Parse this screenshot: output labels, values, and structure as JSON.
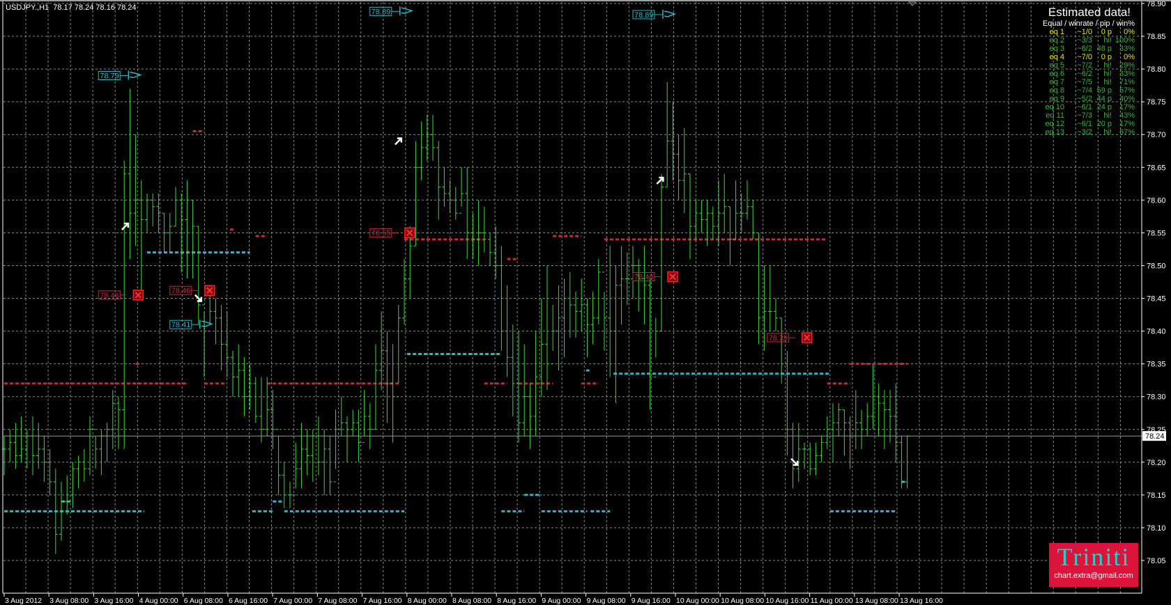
{
  "header": {
    "symbol_line": "USDJPY.,H1  78.17 78.24 78.16 78.24"
  },
  "stats": {
    "title": "Estimated data!",
    "header": "Equal / winrate / pip / win%",
    "rows": [
      {
        "eq": "eq 1",
        "rate": "~1/0",
        "pip": "0 p",
        "win": "0%",
        "color": "#e8e800"
      },
      {
        "eq": "eq 2",
        "rate": "~3/3",
        "pip": "hi!",
        "win": "100%",
        "color": "#3cb43c"
      },
      {
        "eq": "eq 3",
        "rate": "~6/2",
        "pip": "48 p",
        "win": "33%",
        "color": "#3cb43c"
      },
      {
        "eq": "eq 4",
        "rate": "~7/0",
        "pip": "0 p",
        "win": "0%",
        "color": "#e8e800"
      },
      {
        "eq": "eq 5",
        "rate": "~7/2",
        "pip": "hi!",
        "win": "29%",
        "color": "#3cb43c"
      },
      {
        "eq": "eq 6",
        "rate": "~6/2",
        "pip": "hi!",
        "win": "33%",
        "color": "#3cb43c"
      },
      {
        "eq": "eq 7",
        "rate": "~7/5",
        "pip": "hi!",
        "win": "71%",
        "color": "#3cb43c"
      },
      {
        "eq": "eq 8",
        "rate": "~7/4",
        "pip": "59 p",
        "win": "57%",
        "color": "#3cb43c"
      },
      {
        "eq": "eq 9",
        "rate": "~5/2",
        "pip": "44 p",
        "win": "40%",
        "color": "#3cb43c"
      },
      {
        "eq": "eq 10",
        "rate": "~6/1",
        "pip": "24 p",
        "win": "17%",
        "color": "#3cb43c"
      },
      {
        "eq": "eq 11",
        "rate": "~7/3",
        "pip": "hi!",
        "win": "43%",
        "color": "#3cb43c"
      },
      {
        "eq": "eq 12",
        "rate": "~6/1",
        "pip": "20 p",
        "win": "17%",
        "color": "#3cb43c"
      },
      {
        "eq": "eq 13",
        "rate": "~3/2",
        "pip": "hi!",
        "win": "67%",
        "color": "#3cb43c"
      }
    ]
  },
  "logo": {
    "brand": "Triniti",
    "email": "chart.extra@gmail.com"
  },
  "colors": {
    "bar": "#3ed83e",
    "grid": "#8a8a8a",
    "red": "#c8283c",
    "cyan": "#2ab8c8",
    "axis": "#ffffff"
  },
  "chart_data": {
    "type": "ohlc",
    "title": "USDJPY.,H1",
    "ylim": [
      78.03,
      78.9
    ],
    "y_ticks": [
      "78.90",
      "78.85",
      "78.80",
      "78.75",
      "78.70",
      "78.65",
      "78.60",
      "78.55",
      "78.50",
      "78.45",
      "78.40",
      "78.35",
      "78.30",
      "78.25",
      "78.20",
      "78.15",
      "78.10",
      "78.05"
    ],
    "current_price": "78.24",
    "x_ticks": [
      "3 Aug 2012",
      "3 Aug 08:00",
      "3 Aug 16:00",
      "4 Aug 00:00",
      "6 Aug 08:00",
      "6 Aug 16:00",
      "7 Aug 00:00",
      "7 Aug 08:00",
      "7 Aug 16:00",
      "8 Aug 00:00",
      "8 Aug 08:00",
      "8 Aug 16:00",
      "9 Aug 00:00",
      "9 Aug 08:00",
      "9 Aug 16:00",
      "10 Aug 00:00",
      "10 Aug 08:00",
      "10 Aug 16:00",
      "11 Aug 00:00",
      "13 Aug 08:00",
      "13 Aug 16:00"
    ],
    "bars_hlc": [
      [
        78.24,
        78.18,
        78.22
      ],
      [
        78.25,
        78.2,
        78.23
      ],
      [
        78.26,
        78.19,
        78.21
      ],
      [
        78.27,
        78.2,
        78.22
      ],
      [
        78.25,
        78.19,
        78.24
      ],
      [
        78.27,
        78.18,
        78.21
      ],
      [
        78.26,
        78.19,
        78.22
      ],
      [
        78.24,
        78.17,
        78.2
      ],
      [
        78.22,
        78.15,
        78.17
      ],
      [
        78.19,
        78.06,
        78.09
      ],
      [
        78.17,
        78.08,
        78.14
      ],
      [
        78.18,
        78.12,
        78.15
      ],
      [
        78.2,
        78.13,
        78.19
      ],
      [
        78.21,
        78.16,
        78.2
      ],
      [
        78.22,
        78.17,
        78.19
      ],
      [
        78.27,
        78.18,
        78.25
      ],
      [
        78.24,
        78.19,
        78.22
      ],
      [
        78.25,
        78.18,
        78.24
      ],
      [
        78.26,
        78.2,
        78.25
      ],
      [
        78.31,
        78.22,
        78.29
      ],
      [
        78.3,
        78.22,
        78.28
      ],
      [
        78.66,
        78.22,
        78.64
      ],
      [
        78.77,
        78.51,
        78.58
      ],
      [
        78.7,
        78.53,
        78.6
      ],
      [
        78.63,
        78.45,
        78.57
      ],
      [
        78.61,
        78.55,
        78.6
      ],
      [
        78.61,
        78.56,
        78.59
      ],
      [
        78.61,
        78.55,
        78.58
      ],
      [
        78.58,
        78.52,
        78.55
      ],
      [
        78.58,
        78.52,
        78.56
      ],
      [
        78.62,
        78.56,
        78.6
      ],
      [
        78.61,
        78.49,
        78.57
      ],
      [
        78.63,
        78.48,
        78.6
      ],
      [
        78.6,
        78.48,
        78.56
      ],
      [
        78.56,
        78.41,
        78.44
      ],
      [
        78.43,
        78.33,
        78.4
      ],
      [
        78.46,
        78.41,
        78.43
      ],
      [
        78.45,
        78.38,
        78.42
      ],
      [
        78.44,
        78.34,
        78.38
      ],
      [
        78.43,
        78.33,
        78.36
      ],
      [
        78.37,
        78.3,
        78.33
      ],
      [
        78.38,
        78.3,
        78.34
      ],
      [
        78.36,
        78.27,
        78.3
      ],
      [
        78.35,
        78.28,
        78.32
      ],
      [
        78.33,
        78.26,
        78.27
      ],
      [
        78.33,
        78.23,
        78.25
      ],
      [
        78.33,
        78.24,
        78.28
      ],
      [
        78.31,
        78.22,
        78.25
      ],
      [
        78.24,
        78.15,
        78.18
      ],
      [
        78.2,
        78.13,
        78.15
      ],
      [
        78.17,
        78.13,
        78.15
      ],
      [
        78.23,
        78.16,
        78.19
      ],
      [
        78.26,
        78.16,
        78.22
      ],
      [
        78.25,
        78.18,
        78.21
      ],
      [
        78.25,
        78.17,
        78.24
      ],
      [
        78.27,
        78.18,
        78.2
      ],
      [
        78.25,
        78.15,
        78.22
      ],
      [
        78.24,
        78.15,
        78.17
      ],
      [
        78.28,
        78.19,
        78.25
      ],
      [
        78.3,
        78.24,
        78.26
      ],
      [
        78.27,
        78.2,
        78.25
      ],
      [
        78.28,
        78.24,
        78.26
      ],
      [
        78.28,
        78.2,
        78.23
      ],
      [
        78.31,
        78.24,
        78.27
      ],
      [
        78.29,
        78.22,
        78.25
      ],
      [
        78.38,
        78.25,
        78.34
      ],
      [
        78.43,
        78.31,
        78.37
      ],
      [
        78.4,
        78.26,
        78.32
      ],
      [
        78.38,
        78.23,
        78.3
      ],
      [
        78.44,
        78.32,
        78.42
      ],
      [
        78.51,
        78.41,
        78.48
      ],
      [
        78.56,
        78.45,
        78.53
      ],
      [
        78.69,
        78.53,
        78.65
      ],
      [
        78.72,
        78.63,
        78.68
      ],
      [
        78.73,
        78.66,
        78.7
      ],
      [
        78.73,
        78.66,
        78.68
      ],
      [
        78.69,
        78.57,
        78.62
      ],
      [
        78.65,
        78.59,
        78.61
      ],
      [
        78.63,
        78.58,
        78.6
      ],
      [
        78.62,
        78.57,
        78.58
      ],
      [
        78.65,
        78.59,
        78.61
      ],
      [
        78.65,
        78.51,
        78.55
      ],
      [
        78.58,
        78.51,
        78.54
      ],
      [
        78.6,
        78.5,
        78.55
      ],
      [
        78.59,
        78.52,
        78.54
      ],
      [
        78.55,
        78.5,
        78.52
      ],
      [
        78.56,
        78.48,
        78.5
      ],
      [
        78.53,
        78.37,
        78.4
      ],
      [
        78.47,
        78.33,
        78.36
      ],
      [
        78.41,
        78.27,
        78.32
      ],
      [
        78.4,
        78.23,
        78.26
      ],
      [
        78.38,
        78.24,
        78.3
      ],
      [
        78.32,
        78.22,
        78.27
      ],
      [
        78.4,
        78.24,
        78.33
      ],
      [
        78.45,
        78.3,
        78.38
      ],
      [
        78.5,
        78.31,
        78.35
      ],
      [
        78.44,
        78.37,
        78.4
      ],
      [
        78.47,
        78.34,
        78.42
      ],
      [
        78.48,
        78.36,
        78.45
      ],
      [
        78.49,
        78.39,
        78.44
      ],
      [
        78.46,
        78.39,
        78.43
      ],
      [
        78.48,
        78.4,
        78.44
      ],
      [
        78.45,
        78.36,
        78.41
      ],
      [
        78.46,
        78.38,
        78.42
      ],
      [
        78.51,
        78.41,
        78.49
      ],
      [
        78.46,
        78.37,
        78.42
      ],
      [
        78.53,
        78.33,
        78.4
      ],
      [
        78.5,
        78.29,
        78.47
      ],
      [
        78.53,
        78.41,
        78.48
      ],
      [
        78.52,
        78.44,
        78.48
      ],
      [
        78.53,
        78.45,
        78.5
      ],
      [
        78.51,
        78.43,
        78.48
      ],
      [
        78.53,
        78.41,
        78.47
      ],
      [
        78.48,
        78.28,
        78.33
      ],
      [
        78.42,
        78.36,
        78.4
      ],
      [
        78.64,
        78.4,
        78.62
      ],
      [
        78.78,
        78.62,
        78.69
      ],
      [
        78.75,
        78.63,
        78.67
      ],
      [
        78.7,
        78.6,
        78.63
      ],
      [
        78.71,
        78.58,
        78.64
      ],
      [
        78.64,
        78.51,
        78.56
      ],
      [
        78.6,
        78.54,
        78.58
      ],
      [
        78.6,
        78.55,
        78.57
      ],
      [
        78.6,
        78.53,
        78.58
      ],
      [
        78.59,
        78.54,
        78.56
      ],
      [
        78.63,
        78.53,
        78.58
      ],
      [
        78.64,
        78.55,
        78.59
      ],
      [
        78.59,
        78.5,
        78.54
      ],
      [
        78.63,
        78.54,
        78.58
      ],
      [
        78.61,
        78.55,
        78.58
      ],
      [
        78.63,
        78.57,
        78.59
      ],
      [
        78.6,
        78.54,
        78.55
      ],
      [
        78.55,
        78.38,
        78.42
      ],
      [
        78.5,
        78.37,
        78.43
      ],
      [
        78.5,
        78.4,
        78.43
      ],
      [
        78.45,
        78.4,
        78.42
      ],
      [
        78.42,
        78.32,
        78.35
      ],
      [
        78.37,
        78.21,
        78.25
      ],
      [
        78.26,
        78.16,
        78.19
      ],
      [
        78.26,
        78.17,
        78.22
      ],
      [
        78.23,
        78.19,
        78.22
      ],
      [
        78.23,
        78.18,
        78.19
      ],
      [
        78.23,
        78.18,
        78.21
      ],
      [
        78.24,
        78.2,
        78.23
      ],
      [
        78.27,
        78.22,
        78.25
      ],
      [
        78.29,
        78.2,
        78.26
      ],
      [
        78.29,
        78.24,
        78.28
      ],
      [
        78.28,
        78.21,
        78.26
      ],
      [
        78.27,
        78.19,
        78.24
      ],
      [
        78.31,
        78.22,
        78.26
      ],
      [
        78.28,
        78.22,
        78.25
      ],
      [
        78.29,
        78.24,
        78.27
      ],
      [
        78.35,
        78.25,
        78.3
      ],
      [
        78.32,
        78.24,
        78.29
      ],
      [
        78.31,
        78.22,
        78.28
      ],
      [
        78.31,
        78.23,
        78.27
      ],
      [
        78.32,
        78.2,
        78.23
      ],
      [
        78.24,
        78.16,
        78.17
      ],
      [
        78.24,
        78.16,
        78.24
      ]
    ],
    "levels": [
      {
        "price": 78.32,
        "from": 0,
        "to": 32,
        "color": "red"
      },
      {
        "price": 78.32,
        "from": 35,
        "to": 39,
        "color": "red"
      },
      {
        "price": 78.32,
        "from": 46,
        "to": 69,
        "color": "red"
      },
      {
        "price": 78.32,
        "from": 84,
        "to": 88,
        "color": "red"
      },
      {
        "price": 78.32,
        "from": 90,
        "to": 96,
        "color": "red"
      },
      {
        "price": 78.32,
        "from": 101,
        "to": 104,
        "color": "red"
      },
      {
        "price": 78.32,
        "from": 144,
        "to": 148,
        "color": "red"
      },
      {
        "price": 78.54,
        "from": 70,
        "to": 84,
        "color": "red"
      },
      {
        "price": 78.54,
        "from": 105,
        "to": 144,
        "color": "red"
      },
      {
        "price": 78.705,
        "from": 33,
        "to": 35,
        "color": "red"
      },
      {
        "price": 78.545,
        "from": 44,
        "to": 46,
        "color": "red"
      },
      {
        "price": 78.51,
        "from": 88,
        "to": 90,
        "color": "red"
      },
      {
        "price": 78.555,
        "from": 39.5,
        "to": 40.3,
        "color": "red"
      },
      {
        "price": 78.35,
        "from": 148,
        "to": 158,
        "color": "red"
      },
      {
        "price": 78.545,
        "from": 96,
        "to": 101,
        "color": "red"
      },
      {
        "price": 78.35,
        "from": 23,
        "to": 23.6,
        "color": "red"
      },
      {
        "price": 78.52,
        "from": 25,
        "to": 43,
        "color": "cyan"
      },
      {
        "price": 78.125,
        "from": 0,
        "to": 24.5,
        "color": "cyan"
      },
      {
        "price": 78.125,
        "from": 43.4,
        "to": 47,
        "color": "cyan"
      },
      {
        "price": 78.125,
        "from": 49,
        "to": 70,
        "color": "cyan"
      },
      {
        "price": 78.125,
        "from": 87,
        "to": 91,
        "color": "cyan"
      },
      {
        "price": 78.125,
        "from": 94,
        "to": 102,
        "color": "cyan"
      },
      {
        "price": 78.125,
        "from": 102.6,
        "to": 106,
        "color": "cyan"
      },
      {
        "price": 78.125,
        "from": 144.5,
        "to": 156,
        "color": "cyan"
      },
      {
        "price": 78.365,
        "from": 70.5,
        "to": 87,
        "color": "cyan"
      },
      {
        "price": 78.335,
        "from": 106.6,
        "to": 144.5,
        "color": "cyan"
      },
      {
        "price": 78.15,
        "from": 91,
        "to": 94,
        "color": "cyan"
      },
      {
        "price": 78.14,
        "from": 10,
        "to": 11.7,
        "color": "cyan"
      },
      {
        "price": 78.14,
        "from": 47,
        "to": 49,
        "color": "cyan"
      },
      {
        "price": 78.34,
        "from": 101.8,
        "to": 102.4,
        "color": "cyan"
      },
      {
        "price": 78.17,
        "from": 157,
        "to": 158,
        "color": "cyan"
      }
    ],
    "flags": [
      {
        "label": "78.79",
        "price": 78.79,
        "bar": 16.5
      },
      {
        "label": "78.89",
        "price": 78.888,
        "bar": 64
      },
      {
        "label": "78.89",
        "price": 78.883,
        "bar": 110
      },
      {
        "label": "78.41",
        "price": 78.41,
        "bar": 29
      }
    ],
    "stops": [
      {
        "label": "78.46",
        "price": 78.455,
        "bar": 16.5
      },
      {
        "label": "78.46",
        "price": 78.462,
        "bar": 29
      },
      {
        "label": "78.55",
        "price": 78.55,
        "bar": 64
      },
      {
        "label": "78.48",
        "price": 78.483,
        "bar": 110
      },
      {
        "label": "78.39",
        "price": 78.39,
        "bar": 133.5
      }
    ],
    "arrows": [
      {
        "dir": "up",
        "price": 78.56,
        "bar": 21.2
      },
      {
        "dir": "down",
        "price": 78.45,
        "bar": 34
      },
      {
        "dir": "up",
        "price": 78.69,
        "bar": 69
      },
      {
        "dir": "up",
        "price": 78.63,
        "bar": 114.8
      },
      {
        "dir": "down",
        "price": 78.2,
        "bar": 138.3
      }
    ]
  }
}
